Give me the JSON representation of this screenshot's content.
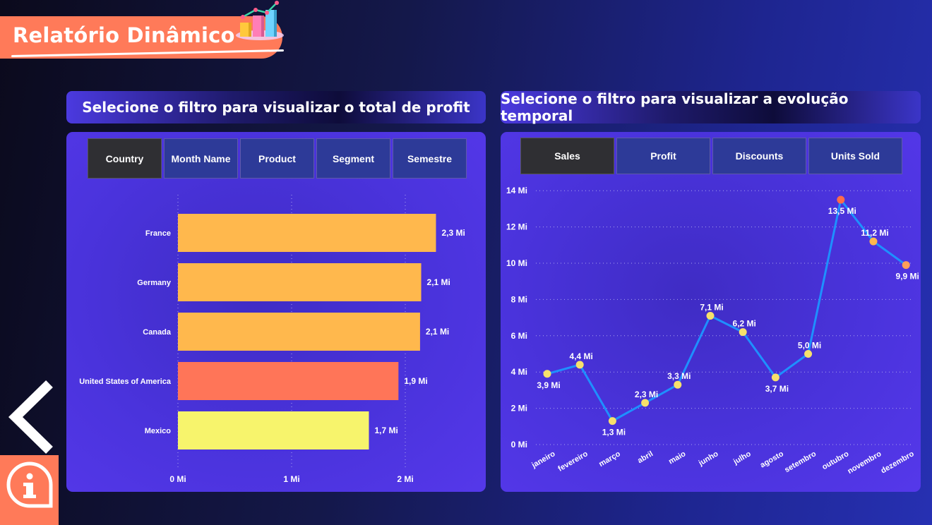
{
  "header": {
    "title": "Relatório Dinâmico",
    "icon": "bar-chart-3d-icon"
  },
  "left_panel": {
    "title": "Selecione o filtro para visualizar o total de profit",
    "tabs": [
      {
        "label": "Country",
        "active": true
      },
      {
        "label": "Month Name",
        "active": false
      },
      {
        "label": "Product",
        "active": false
      },
      {
        "label": "Segment",
        "active": false
      },
      {
        "label": "Semestre",
        "active": false
      }
    ]
  },
  "right_panel": {
    "title": "Selecione o filtro para visualizar a evolução temporal",
    "tabs": [
      {
        "label": "Sales",
        "active": true
      },
      {
        "label": "Profit",
        "active": false
      },
      {
        "label": "Discounts",
        "active": false
      },
      {
        "label": "Units Sold",
        "active": false
      }
    ]
  },
  "nav": {
    "back_icon": "chevron-left-icon",
    "info_icon": "info-icon"
  },
  "colors": {
    "banner": "#ff7a59",
    "bar_orange": "#ffb84d",
    "bar_coral": "#ff7558",
    "bar_yellow": "#f7f46c",
    "line": "#1e90ff",
    "marker_yellow": "#f7e06b",
    "marker_orange": "#ff9f59",
    "marker_red": "#ff6b4a"
  },
  "chart_data": [
    {
      "type": "bar",
      "orientation": "horizontal",
      "categories": [
        "France",
        "Germany",
        "Canada",
        "United States of America",
        "Mexico"
      ],
      "values": [
        2.27,
        2.14,
        2.13,
        1.94,
        1.68
      ],
      "value_labels": [
        "2,3 Mi",
        "2,1 Mi",
        "2,1 Mi",
        "1,9 Mi",
        "1,7 Mi"
      ],
      "bar_colors": [
        "#ffb84d",
        "#ffb84d",
        "#ffb84d",
        "#ff7558",
        "#f7f46c"
      ],
      "x_ticks": [
        0,
        1,
        2
      ],
      "x_tick_labels": [
        "0 Mi",
        "1 Mi",
        "2 Mi"
      ],
      "xlim": [
        0,
        2.4
      ],
      "grid": "vertical-dotted"
    },
    {
      "type": "line",
      "categories": [
        "janeiro",
        "fevereiro",
        "março",
        "abril",
        "maio",
        "junho",
        "julho",
        "agosto",
        "setembro",
        "outubro",
        "novembro",
        "dezembro"
      ],
      "values": [
        3.9,
        4.4,
        1.3,
        2.3,
        3.3,
        7.1,
        6.2,
        3.7,
        5.0,
        13.5,
        11.2,
        9.9
      ],
      "value_labels": [
        "3,9 Mi",
        "4,4 Mi",
        "1,3 Mi",
        "2,3 Mi",
        "3,3 Mi",
        "7,1 Mi",
        "6,2 Mi",
        "3,7 Mi",
        "5,0 Mi",
        "13,5 Mi",
        "11,2 Mi",
        "9,9 Mi"
      ],
      "label_positions": [
        "below",
        "above",
        "below",
        "above",
        "above",
        "above",
        "above",
        "below",
        "above",
        "below",
        "above",
        "below"
      ],
      "marker_colors": [
        "#f7e06b",
        "#f7e06b",
        "#f7e06b",
        "#f7e06b",
        "#f7e06b",
        "#f7e06b",
        "#f7e06b",
        "#f7e06b",
        "#f7e06b",
        "#ff6b4a",
        "#ffb84d",
        "#ff9f59"
      ],
      "y_ticks": [
        0,
        2,
        4,
        6,
        8,
        10,
        12,
        14
      ],
      "y_tick_labels": [
        "0 Mi",
        "2 Mi",
        "4 Mi",
        "6 Mi",
        "8 Mi",
        "10 Mi",
        "12 Mi",
        "14 Mi"
      ],
      "ylim": [
        0,
        14
      ],
      "grid": "horizontal-dotted"
    }
  ]
}
